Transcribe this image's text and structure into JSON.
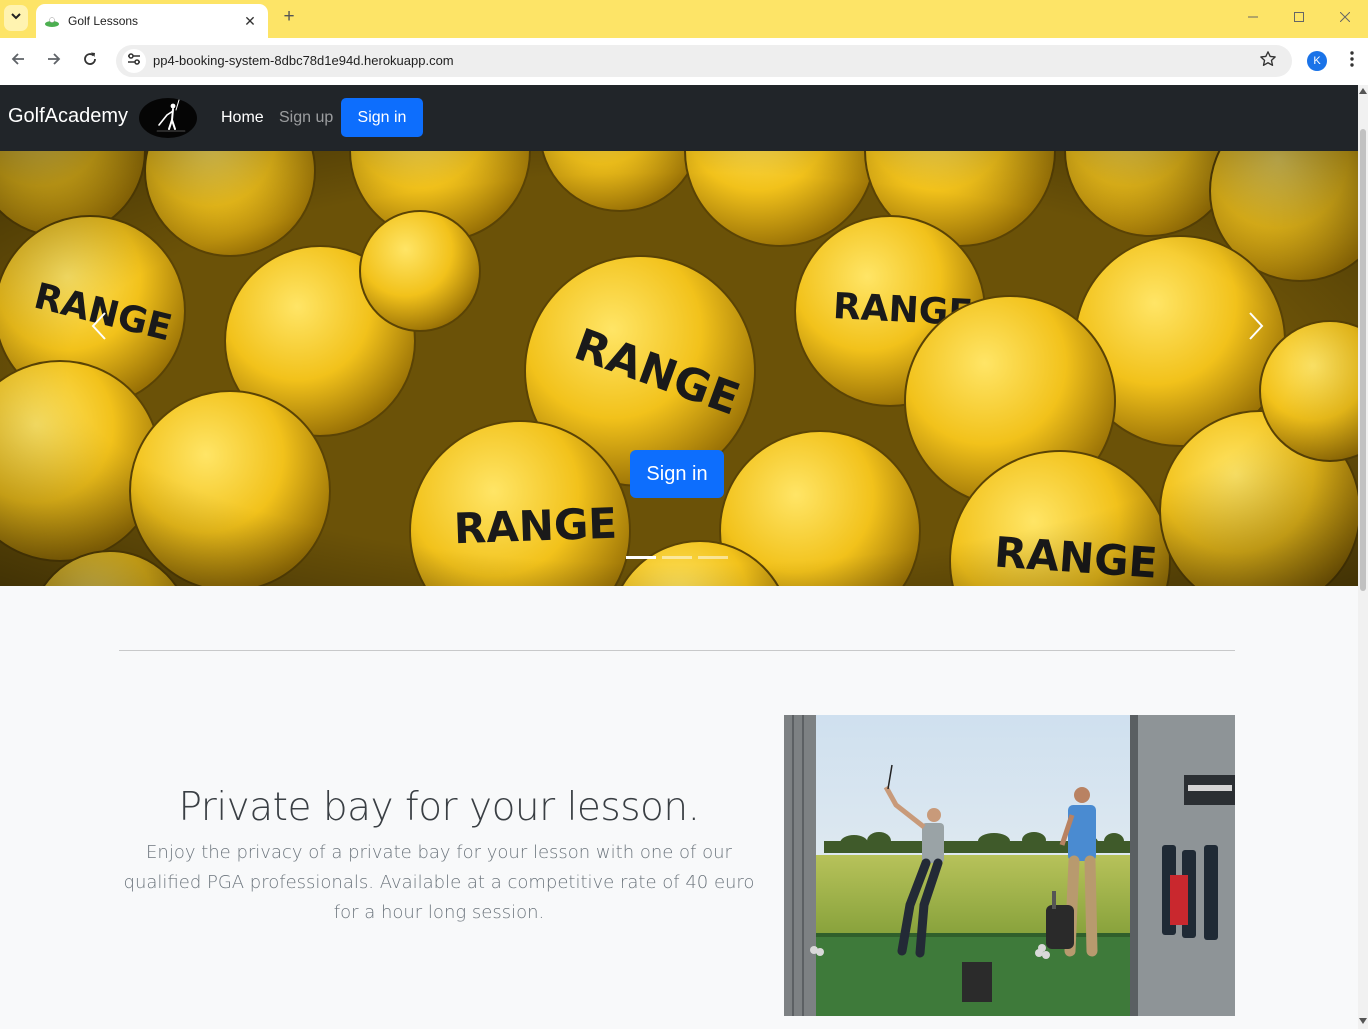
{
  "browser": {
    "tab_title": "Golf Lessons",
    "new_tab": "+",
    "url": "pp4-booking-system-8dbc78d1e94d.herokuapp.com",
    "profile_initial": "K"
  },
  "navbar": {
    "brand": "GolfAcademy",
    "links": [
      "Home",
      "Sign up"
    ],
    "signin": "Sign in"
  },
  "hero": {
    "button": "Sign in",
    "ball_text": "RANGE",
    "slides": 3,
    "active_slide": 1
  },
  "feature": {
    "heading": "Private bay for your lesson.",
    "lead": "Enjoy the privacy of a private bay for your lesson with one of our qualified PGA professionals. Available at a competitive rate of 40 euro for a hour long session."
  },
  "colors": {
    "tabbar": "#fde467",
    "navbar": "#212529",
    "primary": "#0d6efd",
    "page_bg": "#f8f9fa",
    "ball": "#f2c21b"
  }
}
